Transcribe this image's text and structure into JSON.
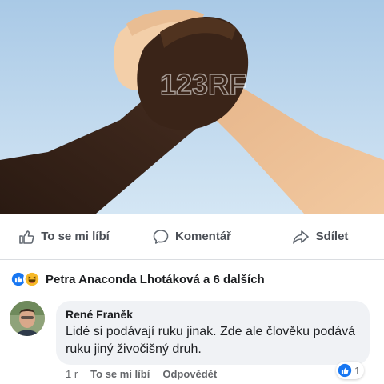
{
  "post": {
    "image": {
      "alt_icon": "handshake-photo",
      "watermark": "123RF"
    },
    "actions": [
      {
        "label": "To se mi líbí",
        "icon": "thumbs-up-outline-icon"
      },
      {
        "label": "Komentář",
        "icon": "comment-bubble-icon"
      },
      {
        "label": "Sdílet",
        "icon": "share-arrow-icon"
      }
    ],
    "reactions": {
      "icons": [
        "like-reaction-icon",
        "haha-reaction-icon"
      ],
      "summary": "Petra Anaconda Lhotáková a 6 dalších"
    }
  },
  "comment": {
    "author": "René Franěk",
    "text": "Lidé si podávají ruku jinak. Zde ale člověku podává ruku jiný živočišný druh.",
    "time": "1 r",
    "like_label": "To se mi líbí",
    "reply_label": "Odpovědět",
    "like_count": "1"
  },
  "colors": {
    "fb_blue": "#1877f2",
    "haha_yellow": "#f7b928",
    "bubble_bg": "#f0f2f5",
    "sky": "#c3dbef"
  }
}
